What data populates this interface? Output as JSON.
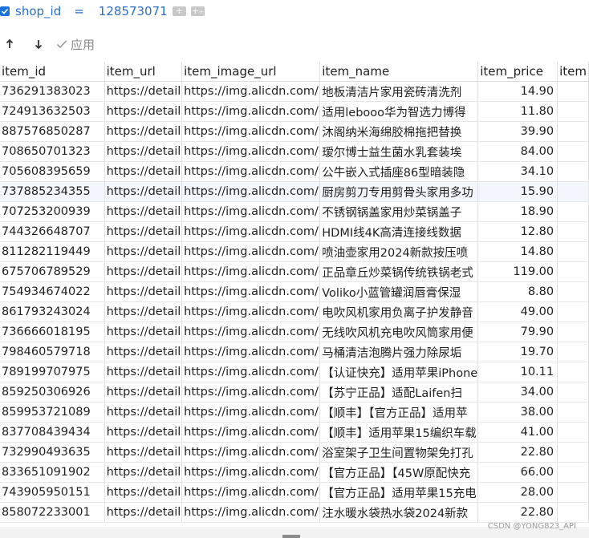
{
  "filter": {
    "field": "shop_id",
    "operator": "=",
    "value": "128573071",
    "add_label": "+",
    "more_label": "+₊"
  },
  "toolbar": {
    "apply_label": "应用"
  },
  "columns": [
    "item_id",
    "item_url",
    "item_image_url",
    "item_name",
    "item_price",
    "item"
  ],
  "rows": [
    {
      "item_id": "736291383023",
      "item_url": "https://detail",
      "item_image_url": "https://img.alicdn.com/",
      "item_name": "地板清洁片家用瓷砖清洗剂",
      "item_price": "14.90"
    },
    {
      "item_id": "724913632503",
      "item_url": "https://detail",
      "item_image_url": "https://img.alicdn.com/",
      "item_name": "适用lebooo华为智选力博得",
      "item_price": "11.80"
    },
    {
      "item_id": "887576850287",
      "item_url": "https://detail",
      "item_image_url": "https://img.alicdn.com/",
      "item_name": "沐阁纳米海绵胶棉拖把替换",
      "item_price": "39.90"
    },
    {
      "item_id": "708650701323",
      "item_url": "https://detail",
      "item_image_url": "https://img.alicdn.com/",
      "item_name": "瑷尔博士益生菌水乳套装埃",
      "item_price": "84.00"
    },
    {
      "item_id": "705608395659",
      "item_url": "https://detail",
      "item_image_url": "https://img.alicdn.com/",
      "item_name": "公牛嵌入式插座86型暗装隐",
      "item_price": "34.10"
    },
    {
      "item_id": "737885234355",
      "item_url": "https://detail",
      "item_image_url": "https://img.alicdn.com/",
      "item_name": "厨房剪刀专用剪骨头家用多功",
      "item_price": "15.90"
    },
    {
      "item_id": "707253200939",
      "item_url": "https://detail",
      "item_image_url": "https://img.alicdn.com/",
      "item_name": "不锈钢锅盖家用炒菜锅盖子",
      "item_price": "18.90"
    },
    {
      "item_id": "744326648707",
      "item_url": "https://detail",
      "item_image_url": "https://img.alicdn.com/",
      "item_name": "HDMI线4K高清连接线数据",
      "item_price": "12.80"
    },
    {
      "item_id": "811282119449",
      "item_url": "https://detail",
      "item_image_url": "https://img.alicdn.com/",
      "item_name": "喷油壶家用2024新款按压喷",
      "item_price": "14.80"
    },
    {
      "item_id": "675706789529",
      "item_url": "https://detail",
      "item_image_url": "https://img.alicdn.com/",
      "item_name": "正品章丘炒菜锅传统铁锅老式",
      "item_price": "119.00"
    },
    {
      "item_id": "754934674022",
      "item_url": "https://detail",
      "item_image_url": "https://img.alicdn.com/",
      "item_name": "Voliko小蓝管罐润唇膏保湿",
      "item_price": "8.80"
    },
    {
      "item_id": "861793243024",
      "item_url": "https://detail",
      "item_image_url": "https://img.alicdn.com/",
      "item_name": "电吹风机家用负离子护发静音",
      "item_price": "49.00"
    },
    {
      "item_id": "736666018195",
      "item_url": "https://detail",
      "item_image_url": "https://img.alicdn.com/",
      "item_name": "无线吹风机充电吹风筒家用便",
      "item_price": "79.90"
    },
    {
      "item_id": "798460579718",
      "item_url": "https://detail",
      "item_image_url": "https://img.alicdn.com/",
      "item_name": "马桶清洁泡腾片强力除尿垢",
      "item_price": "19.70"
    },
    {
      "item_id": "789199707975",
      "item_url": "https://detail",
      "item_image_url": "https://img.alicdn.com/",
      "item_name": "【认证快充】适用苹果iPhone",
      "item_price": "10.11"
    },
    {
      "item_id": "859250306926",
      "item_url": "https://detail",
      "item_image_url": "https://img.alicdn.com/",
      "item_name": "【苏宁正品】适配Laifen扫",
      "item_price": "34.00"
    },
    {
      "item_id": "859953721089",
      "item_url": "https://detail",
      "item_image_url": "https://img.alicdn.com/",
      "item_name": "【顺丰】【官方正品】适用苹",
      "item_price": "38.00"
    },
    {
      "item_id": "837708439434",
      "item_url": "https://detail",
      "item_image_url": "https://img.alicdn.com/",
      "item_name": "【顺丰】适用苹果15编织车载",
      "item_price": "41.00"
    },
    {
      "item_id": "732990493635",
      "item_url": "https://detail",
      "item_image_url": "https://img.alicdn.com/",
      "item_name": "浴室架子卫生间置物架免打孔",
      "item_price": "22.80"
    },
    {
      "item_id": "833651091902",
      "item_url": "https://detail",
      "item_image_url": "https://img.alicdn.com/",
      "item_name": "【官方正品】【45W原配快充",
      "item_price": "66.00"
    },
    {
      "item_id": "743905950151",
      "item_url": "https://detail",
      "item_image_url": "https://img.alicdn.com/",
      "item_name": "【官方正品】适用苹果15充电",
      "item_price": "28.00"
    },
    {
      "item_id": "858072233001",
      "item_url": "https://detail",
      "item_image_url": "https://img.alicdn.com/",
      "item_name": "注水暖水袋热水袋2024新款",
      "item_price": "22.80"
    }
  ],
  "selected_row": 5,
  "watermark": "CSDN @YONG823_API",
  "colors": {
    "accent": "#1a73d9",
    "selected_row": "#f3f7fd"
  }
}
